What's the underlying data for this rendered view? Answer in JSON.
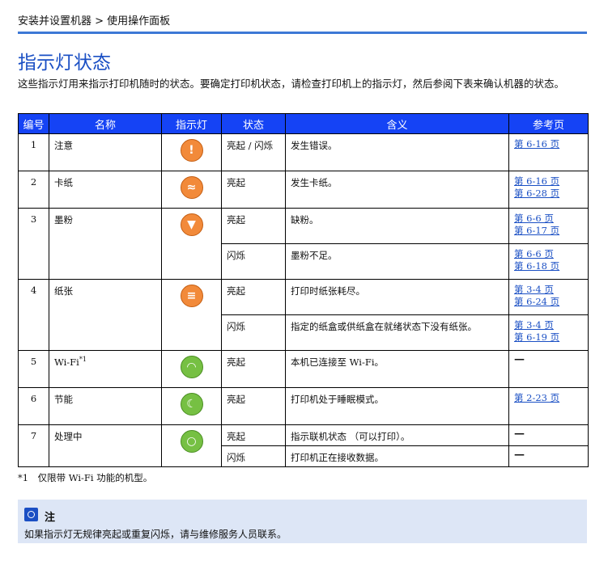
{
  "breadcrumb": "安装并设置机器 > 使用操作面板",
  "title": "指示灯状态",
  "intro": "这些指示灯用来指示打印机随时的状态。要确定打印机状态，请检查打印机上的指示灯，然后参阅下表来确认机器的状态。",
  "table": {
    "headers": [
      "编号",
      "名称",
      "指示灯",
      "状态",
      "含义",
      "参考页"
    ],
    "groups": [
      {
        "num": "1",
        "name": "注意",
        "icon": "warning-icon",
        "glyph": "!",
        "color": "orange",
        "rows": [
          {
            "state": "亮起 / 闪烁",
            "meaning": "发生错误。",
            "refs": [
              "第 6-16 页"
            ]
          }
        ]
      },
      {
        "num": "2",
        "name": "卡纸",
        "icon": "paper-jam-icon",
        "glyph": "≈",
        "color": "orange",
        "rows": [
          {
            "state": "亮起",
            "meaning": "发生卡纸。",
            "refs": [
              "第 6-16 页",
              "第 6-28 页"
            ]
          }
        ]
      },
      {
        "num": "3",
        "name": "墨粉",
        "icon": "toner-icon",
        "glyph": "▼",
        "color": "orange",
        "rows": [
          {
            "state": "亮起",
            "meaning": "缺粉。",
            "refs": [
              "第 6-6 页",
              "第 6-17 页"
            ]
          },
          {
            "state": "闪烁",
            "meaning": "墨粉不足。",
            "refs": [
              "第 6-6 页",
              "第 6-18 页"
            ]
          }
        ]
      },
      {
        "num": "4",
        "name": "纸张",
        "icon": "paper-icon",
        "glyph": "≡",
        "color": "orange",
        "rows": [
          {
            "state": "亮起",
            "meaning": "打印时纸张耗尽。",
            "refs": [
              "第 3-4 页",
              "第 6-24 页"
            ]
          },
          {
            "state": "闪烁",
            "meaning": "指定的纸盒或供纸盒在就绪状态下没有纸张。",
            "refs": [
              "第 3-4 页",
              "第 6-19 页"
            ]
          }
        ]
      },
      {
        "num": "5",
        "name": "Wi-Fi",
        "name_sup": "*1",
        "icon": "wifi-icon",
        "glyph": "◠",
        "color": "green",
        "rows": [
          {
            "state": "亮起",
            "meaning": "本机已连接至 Wi-Fi。",
            "refs": [
              "—"
            ]
          }
        ]
      },
      {
        "num": "6",
        "name": "节能",
        "icon": "sleep-moon-icon",
        "glyph": "☾",
        "color": "green",
        "rows": [
          {
            "state": "亮起",
            "meaning": "打印机处于睡眠模式。",
            "refs": [
              "第 2-23 页"
            ]
          }
        ]
      },
      {
        "num": "7",
        "name": "处理中",
        "icon": "processing-icon",
        "glyph": "○",
        "color": "green",
        "rows": [
          {
            "state": "亮起",
            "meaning": "指示联机状态 （可以打印）。",
            "refs": [
              "—"
            ]
          },
          {
            "state": "闪烁",
            "meaning": "打印机正在接收数据。",
            "refs": [
              "—"
            ]
          }
        ]
      }
    ]
  },
  "footnote": "*1　仅限带 Wi-Fi 功能的机型。",
  "note": {
    "title": "注",
    "text": "如果指示灯无规律亮起或重复闪烁，请与维修服务人员联系。"
  }
}
